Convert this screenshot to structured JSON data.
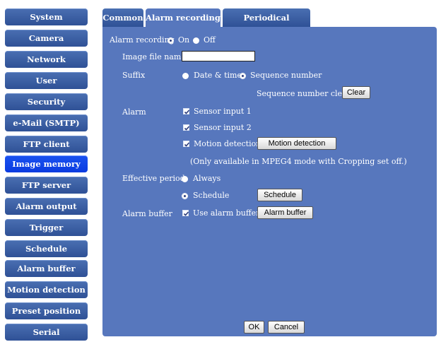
{
  "sidebar": {
    "items": [
      {
        "label": "System"
      },
      {
        "label": "Camera"
      },
      {
        "label": "Network"
      },
      {
        "label": "User"
      },
      {
        "label": "Security"
      },
      {
        "label": "e-Mail (SMTP)"
      },
      {
        "label": "FTP client"
      },
      {
        "label": "Image memory",
        "active": true
      },
      {
        "label": "FTP server"
      },
      {
        "label": "Alarm output"
      },
      {
        "label": "Trigger"
      },
      {
        "label": "Schedule"
      },
      {
        "label": "Alarm buffer"
      },
      {
        "label": "Motion detection"
      },
      {
        "label": "Preset position"
      },
      {
        "label": "Serial"
      }
    ]
  },
  "tabs": [
    {
      "label": "Common"
    },
    {
      "label": "Alarm recording",
      "active": true
    },
    {
      "label": "Periodical recording"
    }
  ],
  "form": {
    "alarm_recording_label": "Alarm recording",
    "on_label": "On",
    "off_label": "Off",
    "image_file_name_label": "Image file name",
    "image_file_name_value": "",
    "suffix_label": "Suffix",
    "date_time_label": "Date & time",
    "sequence_number_label": "Sequence number",
    "sequence_number_clear_label": "Sequence number clear",
    "clear_button": "Clear",
    "alarm_label": "Alarm",
    "sensor_input_1": "Sensor input 1",
    "sensor_input_2": "Sensor input 2",
    "motion_detection_label": "Motion detection",
    "motion_detection_button": "Motion detection",
    "note": "(Only available in MPEG4 mode with Cropping set off.)",
    "effective_period_label": "Effective period",
    "always_label": "Always",
    "schedule_label": "Schedule",
    "schedule_button": "Schedule",
    "alarm_buffer_label": "Alarm buffer",
    "use_alarm_buffer_label": "Use alarm buffer",
    "alarm_buffer_button": "Alarm buffer",
    "ok_button": "OK",
    "cancel_button": "Cancel"
  },
  "colors": {
    "panel": "#5777bd",
    "sidebar": "#3a5ea6",
    "sidebar_active": "#1245e8"
  }
}
